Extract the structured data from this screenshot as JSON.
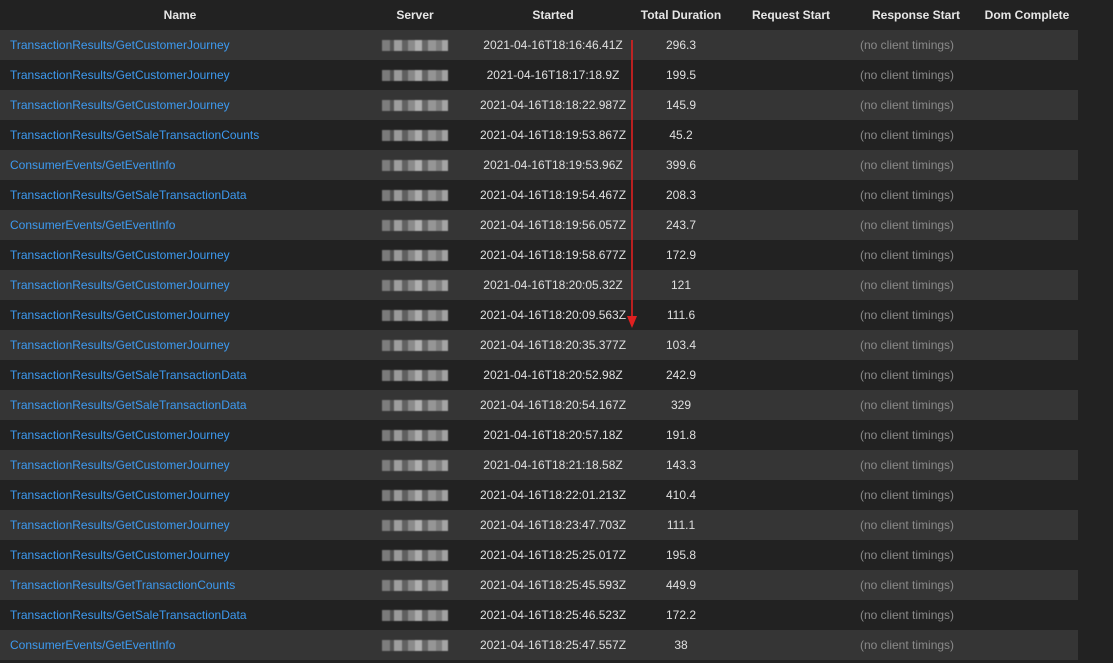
{
  "columns": [
    "Name",
    "Server",
    "Started",
    "Total Duration",
    "Request Start",
    "Response Start",
    "Dom Complete"
  ],
  "rows": [
    {
      "name": "TransactionResults/GetCustomerJourney",
      "started": "2021-04-16T18:16:46.41Z",
      "duration": "296.3",
      "response": "(no client timings)"
    },
    {
      "name": "TransactionResults/GetCustomerJourney",
      "started": "2021-04-16T18:17:18.9Z",
      "duration": "199.5",
      "response": "(no client timings)"
    },
    {
      "name": "TransactionResults/GetCustomerJourney",
      "started": "2021-04-16T18:18:22.987Z",
      "duration": "145.9",
      "response": "(no client timings)"
    },
    {
      "name": "TransactionResults/GetSaleTransactionCounts",
      "started": "2021-04-16T18:19:53.867Z",
      "duration": "45.2",
      "response": "(no client timings)"
    },
    {
      "name": "ConsumerEvents/GetEventInfo",
      "started": "2021-04-16T18:19:53.96Z",
      "duration": "399.6",
      "response": "(no client timings)"
    },
    {
      "name": "TransactionResults/GetSaleTransactionData",
      "started": "2021-04-16T18:19:54.467Z",
      "duration": "208.3",
      "response": "(no client timings)"
    },
    {
      "name": "ConsumerEvents/GetEventInfo",
      "started": "2021-04-16T18:19:56.057Z",
      "duration": "243.7",
      "response": "(no client timings)"
    },
    {
      "name": "TransactionResults/GetCustomerJourney",
      "started": "2021-04-16T18:19:58.677Z",
      "duration": "172.9",
      "response": "(no client timings)"
    },
    {
      "name": "TransactionResults/GetCustomerJourney",
      "started": "2021-04-16T18:20:05.32Z",
      "duration": "121",
      "response": "(no client timings)"
    },
    {
      "name": "TransactionResults/GetCustomerJourney",
      "started": "2021-04-16T18:20:09.563Z",
      "duration": "111.6",
      "response": "(no client timings)"
    },
    {
      "name": "TransactionResults/GetCustomerJourney",
      "started": "2021-04-16T18:20:35.377Z",
      "duration": "103.4",
      "response": "(no client timings)"
    },
    {
      "name": "TransactionResults/GetSaleTransactionData",
      "started": "2021-04-16T18:20:52.98Z",
      "duration": "242.9",
      "response": "(no client timings)"
    },
    {
      "name": "TransactionResults/GetSaleTransactionData",
      "started": "2021-04-16T18:20:54.167Z",
      "duration": "329",
      "response": "(no client timings)"
    },
    {
      "name": "TransactionResults/GetCustomerJourney",
      "started": "2021-04-16T18:20:57.18Z",
      "duration": "191.8",
      "response": "(no client timings)"
    },
    {
      "name": "TransactionResults/GetCustomerJourney",
      "started": "2021-04-16T18:21:18.58Z",
      "duration": "143.3",
      "response": "(no client timings)"
    },
    {
      "name": "TransactionResults/GetCustomerJourney",
      "started": "2021-04-16T18:22:01.213Z",
      "duration": "410.4",
      "response": "(no client timings)"
    },
    {
      "name": "TransactionResults/GetCustomerJourney",
      "started": "2021-04-16T18:23:47.703Z",
      "duration": "111.1",
      "response": "(no client timings)"
    },
    {
      "name": "TransactionResults/GetCustomerJourney",
      "started": "2021-04-16T18:25:25.017Z",
      "duration": "195.8",
      "response": "(no client timings)"
    },
    {
      "name": "TransactionResults/GetTransactionCounts",
      "started": "2021-04-16T18:25:45.593Z",
      "duration": "449.9",
      "response": "(no client timings)"
    },
    {
      "name": "TransactionResults/GetSaleTransactionData",
      "started": "2021-04-16T18:25:46.523Z",
      "duration": "172.2",
      "response": "(no client timings)"
    },
    {
      "name": "ConsumerEvents/GetEventInfo",
      "started": "2021-04-16T18:25:47.557Z",
      "duration": "38",
      "response": "(no client timings)"
    }
  ],
  "colors": {
    "background": "#222222",
    "row_alt": "#353535",
    "link": "#3d9af0",
    "muted": "#8a8a8a",
    "annotation_arrow": "#e02020"
  }
}
